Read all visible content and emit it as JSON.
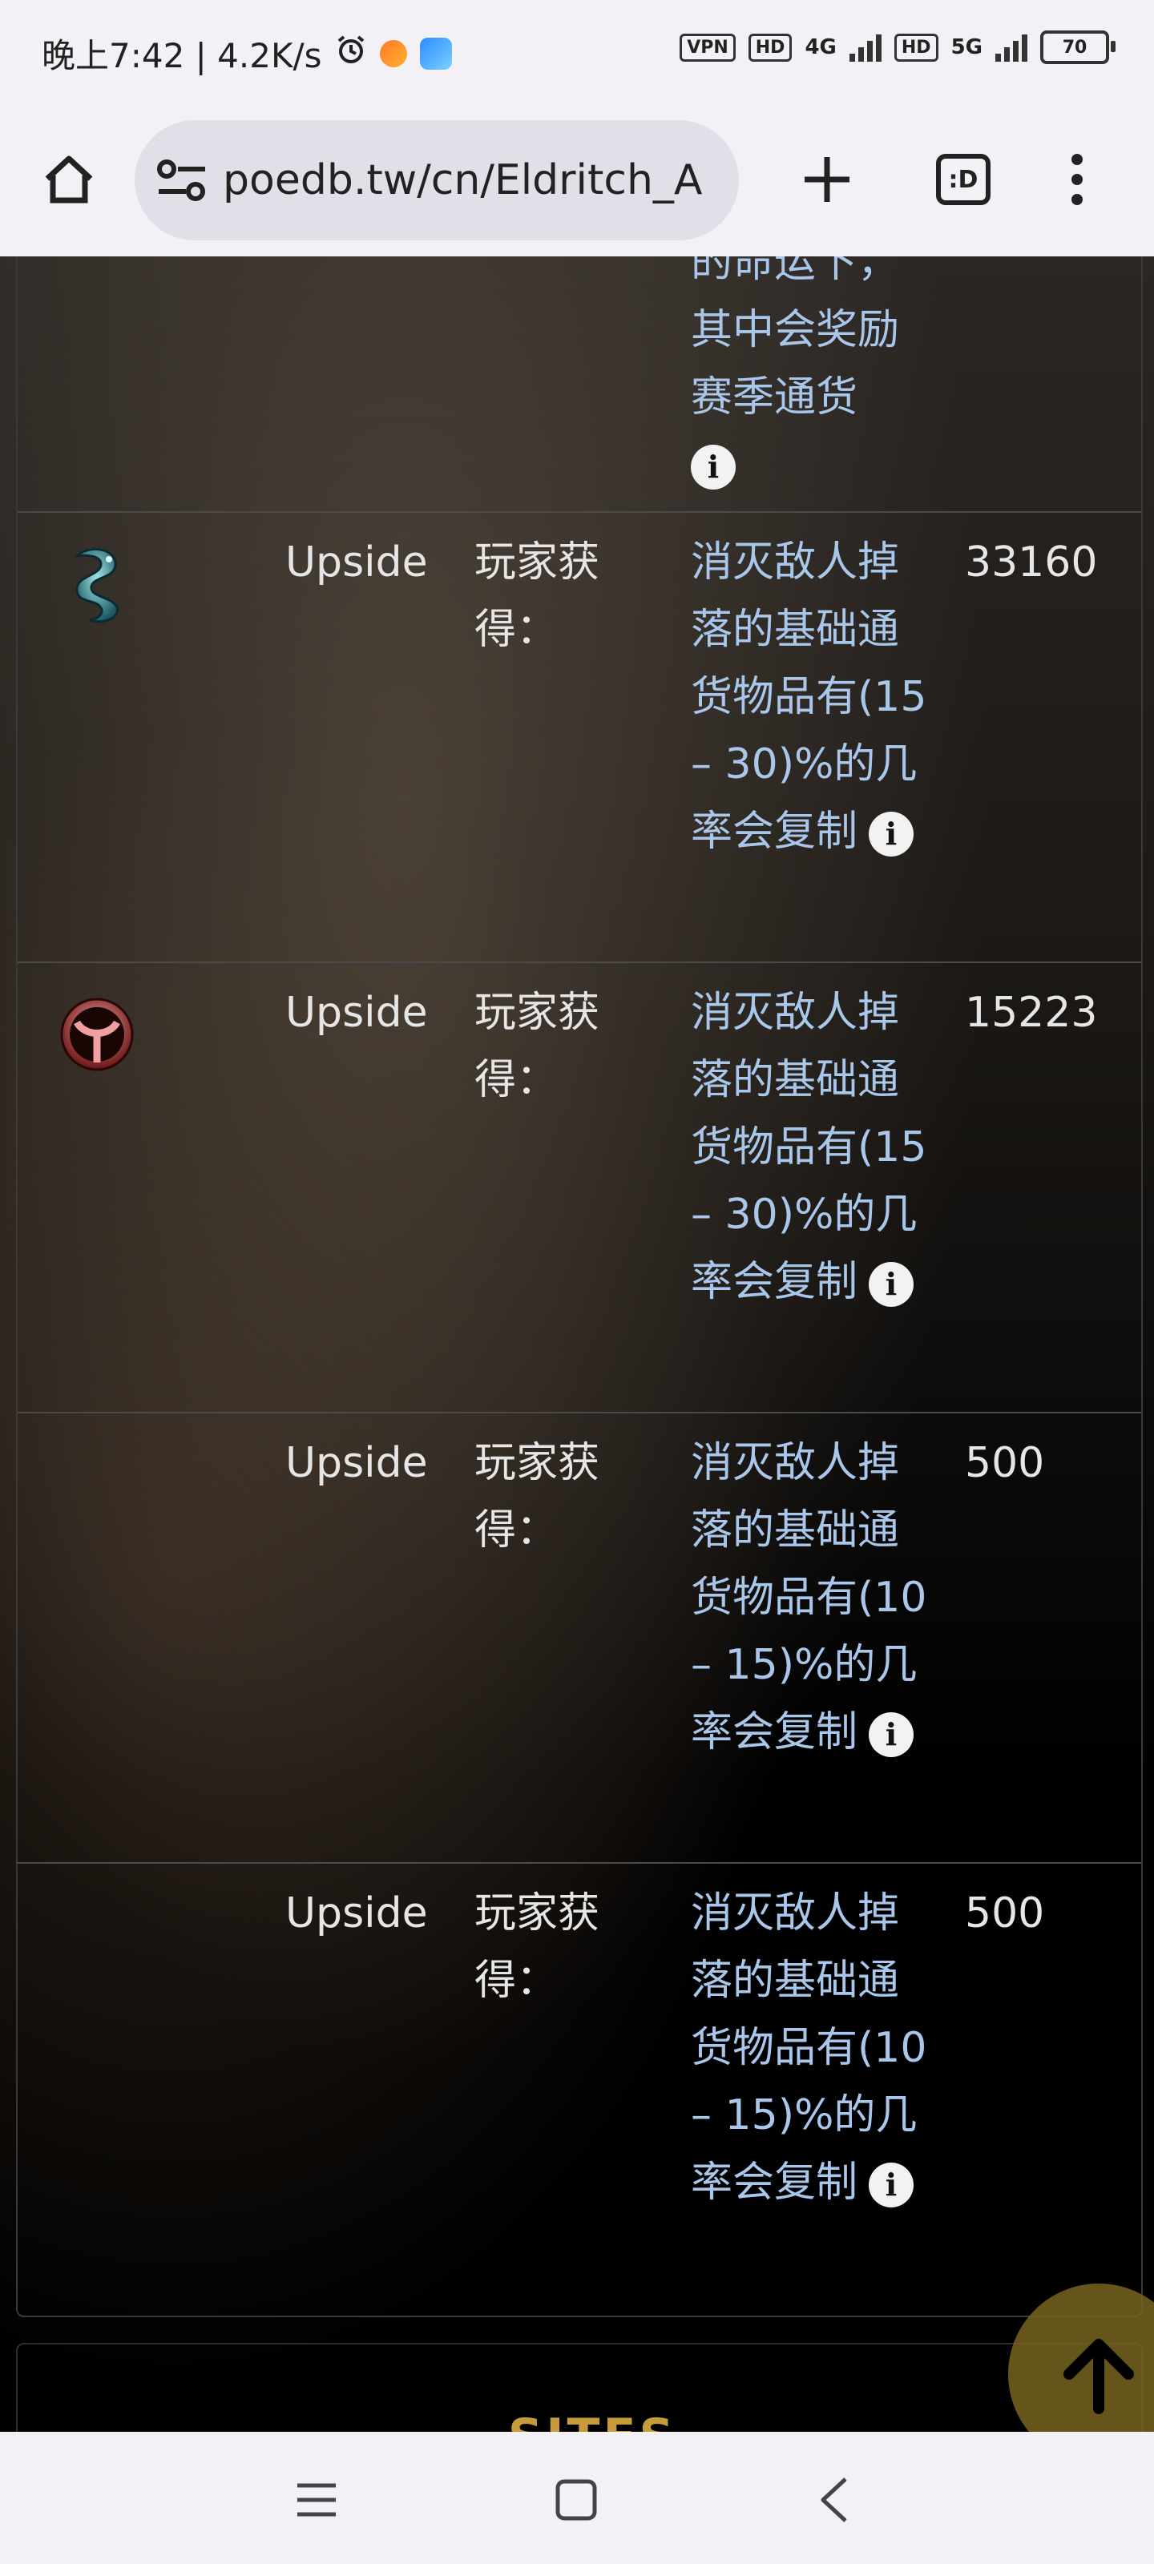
{
  "status_bar": {
    "time": "晚上7:42 | 4.2K/s",
    "vpn": "VPN",
    "hd1": "HD",
    "net1": "4G",
    "hd2": "HD",
    "net2": "5G",
    "battery": "70"
  },
  "browser": {
    "url": "poedb.tw/cn/Eldritch_A",
    "tabs_label": ":D"
  },
  "table": {
    "partial_row": {
      "desc_lines": [
        "的命运下，",
        "其中会奖励",
        "赛季通货"
      ]
    },
    "rows": [
      {
        "icon": "teal-dragon-currency-icon",
        "type": "Upside",
        "label": "玩家获得：",
        "desc": "消灭敌人掉落的基础通货物品有(15 – 30)%的几率会复制",
        "weight": "33160"
      },
      {
        "icon": "red-rune-currency-icon",
        "type": "Upside",
        "label": "玩家获得：",
        "desc": "消灭敌人掉落的基础通货物品有(15 – 30)%的几率会复制",
        "weight": "15223"
      },
      {
        "icon": "",
        "type": "Upside",
        "label": "玩家获得：",
        "desc": "消灭敌人掉落的基础通货物品有(10 – 15)%的几率会复制",
        "weight": "500"
      },
      {
        "icon": "",
        "type": "Upside",
        "label": "玩家获得：",
        "desc": "消灭敌人掉落的基础通货物品有(10 – 15)%的几率会复制",
        "weight": "500"
      }
    ]
  },
  "sites_card": {
    "title": "SITES"
  },
  "colors": {
    "link_blue": "#a9c7ea",
    "gold": "#c79a3a",
    "scroll_button": "#786420"
  }
}
